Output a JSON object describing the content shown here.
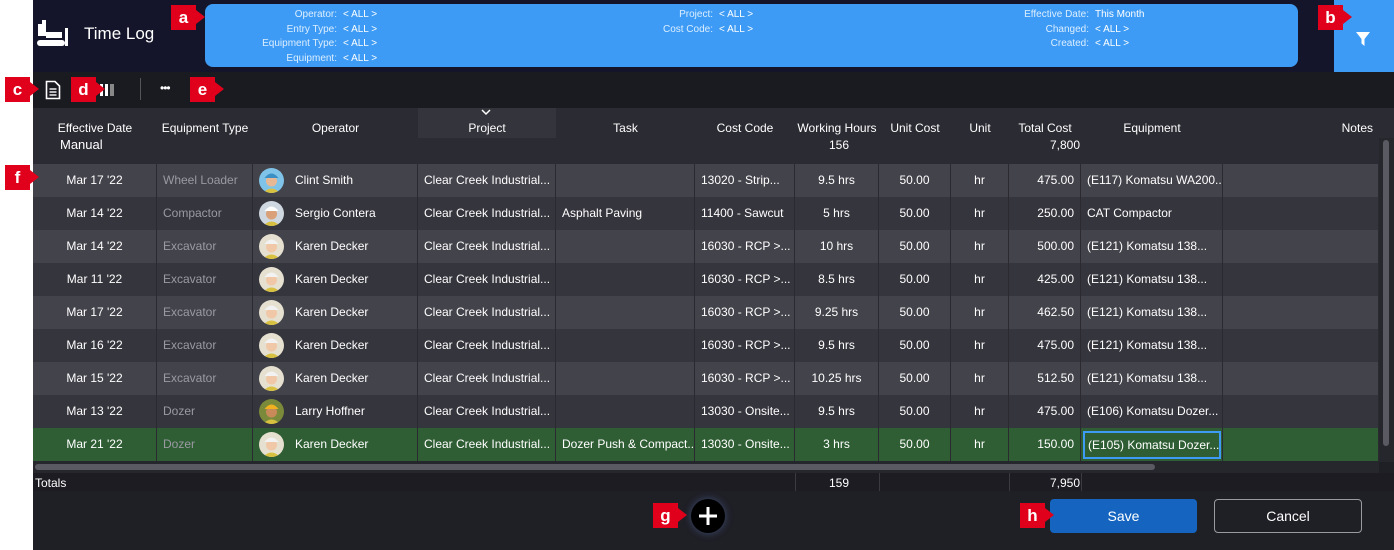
{
  "app": {
    "title": "Time Log"
  },
  "filters": {
    "operator": {
      "label": "Operator:",
      "value": "< ALL >"
    },
    "entry_type": {
      "label": "Entry Type:",
      "value": "< ALL >"
    },
    "equipment_type": {
      "label": "Equipment Type:",
      "value": "< ALL >"
    },
    "equipment": {
      "label": "Equipment:",
      "value": "< ALL >"
    },
    "project": {
      "label": "Project:",
      "value": "< ALL >"
    },
    "cost_code": {
      "label": "Cost Code:",
      "value": "< ALL >"
    },
    "effective_date": {
      "label": "Effective Date:",
      "value": "This Month"
    },
    "changed": {
      "label": "Changed:",
      "value": "< ALL >"
    },
    "created": {
      "label": "Created:",
      "value": "< ALL >"
    }
  },
  "toolbar": {
    "more_label": "•••"
  },
  "columns": [
    "Effective Date",
    "Equipment Type",
    "Operator",
    "Project",
    "Task",
    "Cost Code",
    "Working Hours",
    "Unit Cost",
    "Unit",
    "Total Cost",
    "Equipment",
    "Notes"
  ],
  "group": {
    "label": "Manual",
    "working_hours": "156",
    "total_cost": "7,800"
  },
  "rows": [
    {
      "date": "Mar 17 '22",
      "equip_type": "Wheel Loader",
      "operator": "Clint Smith",
      "project": "Clear Creek Industrial...",
      "task": "",
      "cost_code": "13020 - Strip...",
      "hours": "9.5 hrs",
      "unit_cost": "50.00",
      "unit": "hr",
      "total": "475.00",
      "equipment": "(E117) Komatsu WA200...",
      "notes": ""
    },
    {
      "date": "Mar 14 '22",
      "equip_type": "Compactor",
      "operator": "Sergio Contera",
      "project": "Clear Creek Industrial...",
      "task": "Asphalt Paving",
      "cost_code": "11400  - Sawcut",
      "hours": "5 hrs",
      "unit_cost": "50.00",
      "unit": "hr",
      "total": "250.00",
      "equipment": "CAT Compactor",
      "notes": ""
    },
    {
      "date": "Mar 14 '22",
      "equip_type": "Excavator",
      "operator": "Karen Decker",
      "project": "Clear Creek Industrial...",
      "task": "",
      "cost_code": "16030 - RCP >...",
      "hours": "10 hrs",
      "unit_cost": "50.00",
      "unit": "hr",
      "total": "500.00",
      "equipment": "(E121) Komatsu 138...",
      "notes": ""
    },
    {
      "date": "Mar 11 '22",
      "equip_type": "Excavator",
      "operator": "Karen Decker",
      "project": "Clear Creek Industrial...",
      "task": "",
      "cost_code": "16030 - RCP >...",
      "hours": "8.5 hrs",
      "unit_cost": "50.00",
      "unit": "hr",
      "total": "425.00",
      "equipment": "(E121) Komatsu 138...",
      "notes": ""
    },
    {
      "date": "Mar 17 '22",
      "equip_type": "Excavator",
      "operator": "Karen Decker",
      "project": "Clear Creek Industrial...",
      "task": "",
      "cost_code": "16030 - RCP >...",
      "hours": "9.25 hrs",
      "unit_cost": "50.00",
      "unit": "hr",
      "total": "462.50",
      "equipment": "(E121) Komatsu 138...",
      "notes": ""
    },
    {
      "date": "Mar 16 '22",
      "equip_type": "Excavator",
      "operator": "Karen Decker",
      "project": "Clear Creek Industrial...",
      "task": "",
      "cost_code": "16030 - RCP >...",
      "hours": "9.5 hrs",
      "unit_cost": "50.00",
      "unit": "hr",
      "total": "475.00",
      "equipment": "(E121) Komatsu 138...",
      "notes": ""
    },
    {
      "date": "Mar 15 '22",
      "equip_type": "Excavator",
      "operator": "Karen Decker",
      "project": "Clear Creek Industrial...",
      "task": "",
      "cost_code": "16030 - RCP >...",
      "hours": "10.25 hrs",
      "unit_cost": "50.00",
      "unit": "hr",
      "total": "512.50",
      "equipment": "(E121) Komatsu 138...",
      "notes": ""
    },
    {
      "date": "Mar 13 '22",
      "equip_type": "Dozer",
      "operator": "Larry Hoffner",
      "project": "Clear Creek Industrial...",
      "task": "",
      "cost_code": "13030 - Onsite...",
      "hours": "9.5 hrs",
      "unit_cost": "50.00",
      "unit": "hr",
      "total": "475.00",
      "equipment": "(E106) Komatsu Dozer...",
      "notes": ""
    },
    {
      "date": "Mar 21 '22",
      "equip_type": "Dozer",
      "operator": "Karen Decker",
      "project": "Clear Creek Industrial...",
      "task": "Dozer Push & Compact...",
      "cost_code": "13030 - Onsite...",
      "hours": "3 hrs",
      "unit_cost": "50.00",
      "unit": "hr",
      "total": "150.00",
      "equipment": "(E105) Komatsu Dozer...",
      "notes": ""
    }
  ],
  "totals": {
    "label": "Totals",
    "working_hours": "159",
    "total_cost": "7,950"
  },
  "footer": {
    "save_label": "Save",
    "cancel_label": "Cancel"
  },
  "markers": {
    "a": "a",
    "b": "b",
    "c": "c",
    "d": "d",
    "e": "e",
    "f": "f",
    "g": "g",
    "h": "h"
  },
  "colors": {
    "accent": "#3d9bf5",
    "save": "#1565c0",
    "selected_row": "#2f5e34",
    "marker": "#e0001b"
  }
}
